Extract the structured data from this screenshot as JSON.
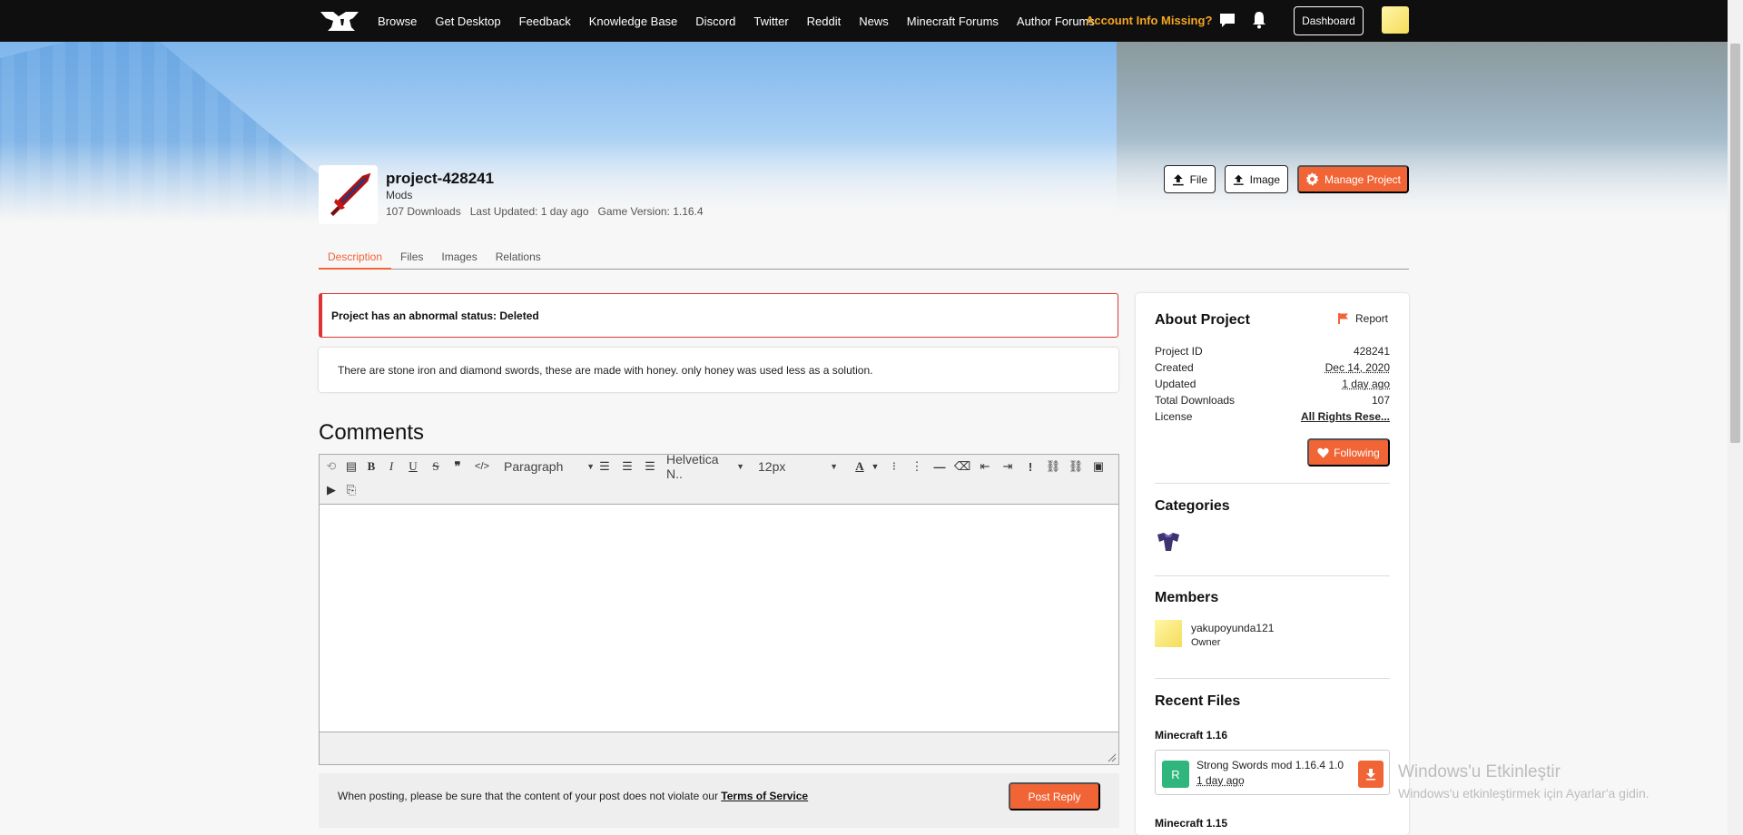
{
  "nav": {
    "links": [
      "Browse",
      "Get Desktop",
      "Feedback",
      "Knowledge Base",
      "Discord",
      "Twitter",
      "Reddit",
      "News",
      "Minecraft Forums",
      "Author Forums"
    ],
    "account_warning": "Account Info Missing?",
    "dashboard_label": "Dashboard"
  },
  "project": {
    "title": "project-428241",
    "category": "Mods",
    "downloads": "107 Downloads",
    "last_updated": "Last Updated: 1 day ago",
    "game_version": "Game Version: 1.16.4",
    "file_button": "File",
    "image_button": "Image",
    "manage_button": "Manage Project"
  },
  "tabs": [
    {
      "label": "Description",
      "active": true
    },
    {
      "label": "Files",
      "active": false
    },
    {
      "label": "Images",
      "active": false
    },
    {
      "label": "Relations",
      "active": false
    }
  ],
  "status_text": "Project has an abnormal status: Deleted",
  "description": "There are stone iron and diamond swords, these are made with honey. only honey was used less as a solution.",
  "comments": {
    "heading": "Comments",
    "editor": {
      "paragraph": "Paragraph",
      "font": "Helvetica N..",
      "size": "12px"
    },
    "post_note_prefix": "When posting, please be sure that the content of your post does not violate our ",
    "tos_link": "Terms of Service",
    "post_button": "Post Reply"
  },
  "sidebar": {
    "about_heading": "About Project",
    "report_label": "Report",
    "details": [
      {
        "key": "Project ID",
        "value": "428241",
        "style": "plain"
      },
      {
        "key": "Created",
        "value": "Dec 14, 2020",
        "style": "dotted"
      },
      {
        "key": "Updated",
        "value": "1 day ago",
        "style": "dotted"
      },
      {
        "key": "Total Downloads",
        "value": "107",
        "style": "plain"
      },
      {
        "key": "License",
        "value": "All Rights Rese...",
        "style": "link"
      }
    ],
    "follow_button": "Following",
    "categories_heading": "Categories",
    "members_heading": "Members",
    "member": {
      "name": "yakupoyunda121",
      "role": "Owner"
    },
    "recent_files_heading": "Recent Files",
    "groups": [
      {
        "version": "Minecraft 1.16",
        "file": {
          "release": "R",
          "name": "Strong Swords mod 1.16.4 1.0",
          "date": "1 day ago"
        }
      },
      {
        "version": "Minecraft 1.15"
      }
    ]
  },
  "watermark": {
    "line1": "Windows'u Etkinleştir",
    "line2": "Windows'u etkinleştirmek için Ayarlar'a gidin."
  },
  "colors": {
    "accent": "#f16436",
    "warning": "#f5a623",
    "error": "#dd3333",
    "release": "#2eb67d"
  }
}
